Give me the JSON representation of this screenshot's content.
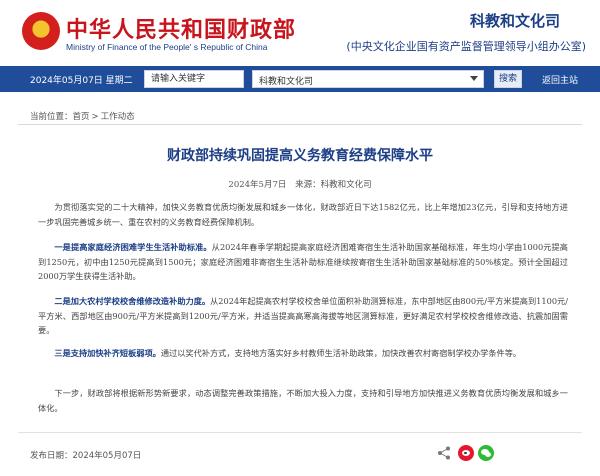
{
  "header": {
    "brand_cn": "中华人民共和国财政部",
    "brand_en": "Ministry of Finance of the People' s Republic of China",
    "department": "科教和文化司",
    "department_sub": "(中央文化企业国有资产监督管理领导小组办公室)"
  },
  "navbar": {
    "date": "2024年05月07日 星期二",
    "search_placeholder": "请输入关键字",
    "select_value": "科教和文化司",
    "search_label": "搜索",
    "home_label": "返回主站"
  },
  "breadcrumb": {
    "prefix": "当前位置：",
    "items": [
      "首页",
      "工作动态"
    ],
    "separator": ">"
  },
  "article": {
    "title": "财政部持续巩固提高义务教育经费保障水平",
    "date": "2024年5月7日",
    "source": "来源：科教和文化司",
    "p1": "为贯彻落实党的二十大精神，加快义务教育优质均衡发展和城乡一体化，财政部近日下达1582亿元，比上年增加23亿元，引导和支持地方进一步巩固完善城乡统一、重在农村的义务教育经费保障机制。",
    "p2_lead": "一是提高家庭经济困难学生生活补助标准。",
    "p2_rest": "从2024年春季学期起提高家庭经济困难寄宿生生活补助国家基础标准，年生均小学由1000元提高到1250元，初中由1250元提高到1500元；家庭经济困难非寄宿生生活补助标准继续按寄宿生生活补助国家基础标准的50%核定。预计全国超过2000万学生获得生活补助。",
    "p3_lead": "二是加大农村学校校舍维修改造补助力度。",
    "p3_rest": "从2024年起提高农村学校校舍单位面积补助测算标准，东中部地区由800元/平方米提高到1100元/平方米、西部地区由900元/平方米提高到1200元/平方米，并适当提高高寒高海拔等地区测算标准，更好满足农村学校校舍维修改造、抗震加固需要。",
    "p4_lead": "三是支持加快补齐短板弱项。",
    "p4_rest": "通过以奖代补方式，支持地方落实好乡村教师生活补助政策，加快改善农村寄宿制学校办学条件等。",
    "p5": "下一步，财政部将根据新形势新要求，动态调整完善政策措施，不断加大投入力度，支持和引导地方加快推进义务教育优质均衡发展和城乡一体化。",
    "publish_label": "发布日期：2024年05月07日"
  },
  "share": {
    "icons": [
      "share-icon",
      "weibo-icon",
      "wechat-icon"
    ],
    "colors": {
      "weibo": "#e6162d",
      "wechat": "#2dbb35"
    }
  },
  "colors": {
    "brand_red": "#c8151d",
    "nav_blue": "#1f4d9a",
    "title_blue": "#1d3f86"
  }
}
